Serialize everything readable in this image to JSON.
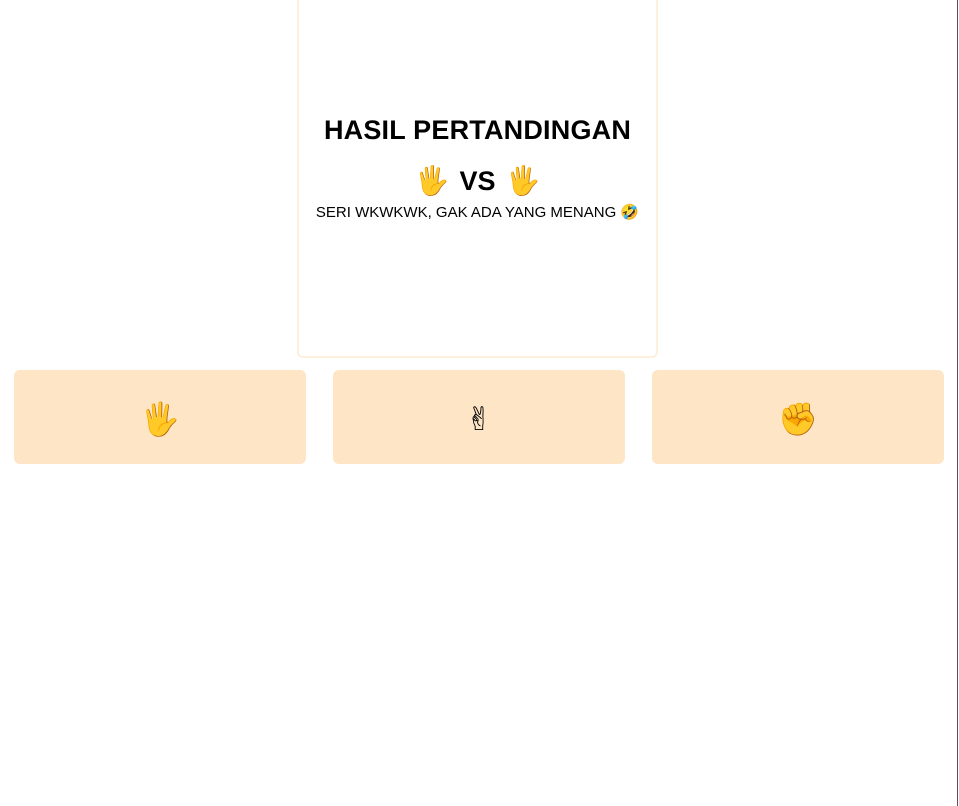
{
  "result": {
    "title": "HASIL PERTANDINGAN",
    "player_hand": "🖐",
    "vs_label": "VS",
    "computer_hand": "🖐",
    "message": "SERI WKWKWK, GAK ADA YANG MENANG 🤣"
  },
  "choices": [
    {
      "name": "paper",
      "icon": "🖐"
    },
    {
      "name": "scissors",
      "icon": "✌"
    },
    {
      "name": "rock",
      "icon": "✊"
    }
  ],
  "colors": {
    "choice_background": "#fde5c5",
    "card_border": "#fdf0dc"
  }
}
